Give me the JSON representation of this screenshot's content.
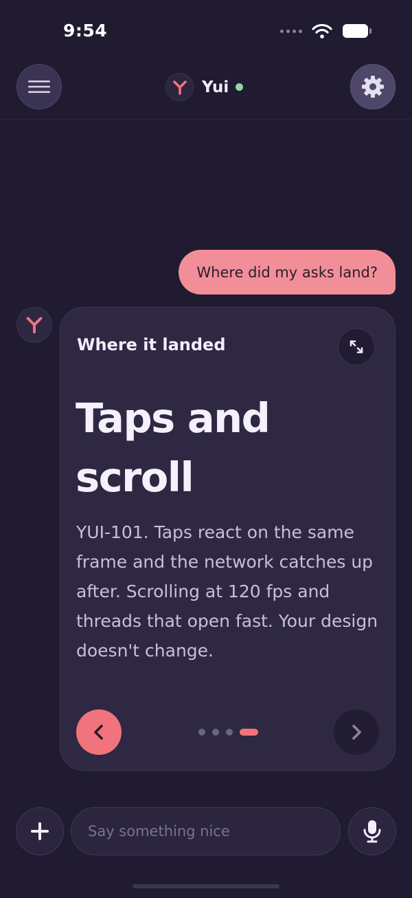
{
  "status_bar": {
    "time": "9:54"
  },
  "header": {
    "title": "Yui",
    "menu_icon": "hamburger-menu-icon",
    "settings_icon": "gear-icon",
    "online_status_color": "#8fd7a6"
  },
  "conversation": {
    "user_message": "Where did my asks land?",
    "bot_card": {
      "heading": "Where it landed",
      "title": "Taps and scroll",
      "body": "YUI-101. Taps react on the same frame and the network catches up after. Scrolling at 120 fps and threads that open fast. Your design doesn't change.",
      "pager": {
        "total": 4,
        "current": 4
      }
    }
  },
  "composer": {
    "placeholder": "Say something nice",
    "value": ""
  },
  "colors": {
    "background": "#201b30",
    "accent": "#f1737d",
    "user_bubble": "#f28e97",
    "card": "#2e2843"
  }
}
